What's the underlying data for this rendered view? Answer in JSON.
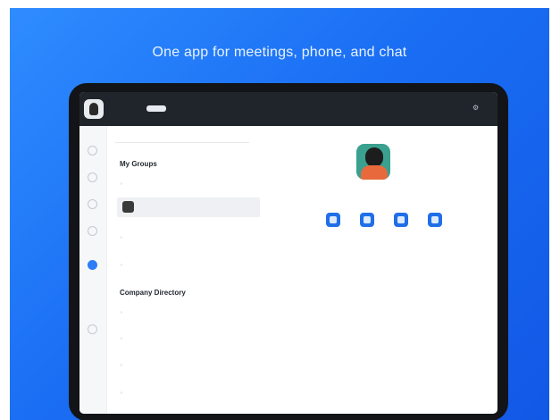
{
  "headline": "One app for meetings, phone, and chat",
  "topbar": {
    "tab_active": "",
    "items": [
      "",
      "",
      "",
      ""
    ]
  },
  "rail": [
    "",
    "",
    "",
    "",
    "",
    ""
  ],
  "search": {
    "placeholder": ""
  },
  "list": {
    "my_groups_title": "My Groups",
    "my_groups": [
      "",
      "",
      "",
      ""
    ],
    "company_title": "Company Directory",
    "company": [
      "",
      "",
      "",
      ""
    ]
  },
  "profile": {
    "name": "",
    "subtitle": "",
    "actions": [
      "",
      "",
      "",
      ""
    ],
    "details": [
      {
        "label": "",
        "value": ""
      },
      {
        "label": "",
        "value": ""
      },
      {
        "label": "",
        "value": ""
      },
      {
        "label": "",
        "value": ""
      },
      {
        "label": "",
        "value": ""
      },
      {
        "label": "",
        "value": ""
      },
      {
        "label": "",
        "value": ""
      }
    ]
  },
  "colors": {
    "banner": "#1a6ef3",
    "accent": "#1f6fe8",
    "device": "#121417"
  }
}
